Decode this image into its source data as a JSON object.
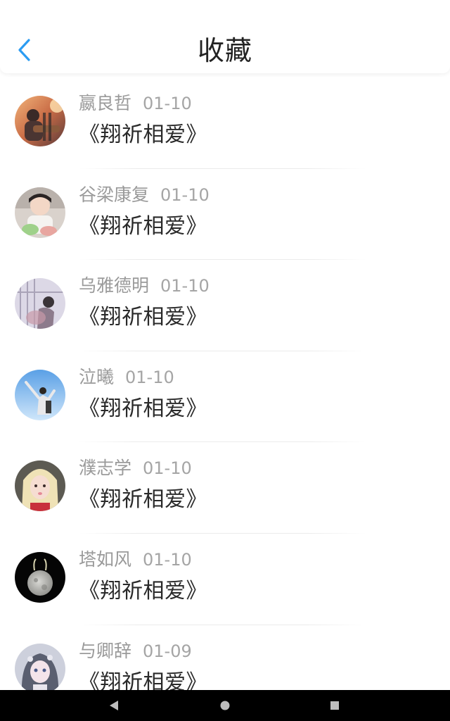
{
  "header": {
    "title": "收藏",
    "back_icon": "chevron-left-icon",
    "accent_color": "#2b9cf2"
  },
  "favorites": [
    {
      "user": "嬴良哲",
      "date": "01-10",
      "song": "《翔祈相爱》",
      "avatar": "avatar-guitar-sunset"
    },
    {
      "user": "谷梁康复",
      "date": "01-10",
      "song": "《翔祈相爱》",
      "avatar": "avatar-boy-cake"
    },
    {
      "user": "乌雅德明",
      "date": "01-10",
      "song": "《翔祈相爱》",
      "avatar": "avatar-girl-window"
    },
    {
      "user": "泣曦",
      "date": "01-10",
      "song": "《翔祈相爱》",
      "avatar": "avatar-man-sky"
    },
    {
      "user": "濮志学",
      "date": "01-10",
      "song": "《翔祈相爱》",
      "avatar": "avatar-blonde-girl"
    },
    {
      "user": "塔如风",
      "date": "01-10",
      "song": "《翔祈相爱》",
      "avatar": "avatar-moon"
    },
    {
      "user": "与卿辞",
      "date": "01-09",
      "song": "《翔祈相爱》",
      "avatar": "avatar-anime-girl"
    }
  ],
  "nav": {
    "back_icon": "triangle-back-icon",
    "home_icon": "circle-home-icon",
    "recents_icon": "square-recents-icon"
  }
}
